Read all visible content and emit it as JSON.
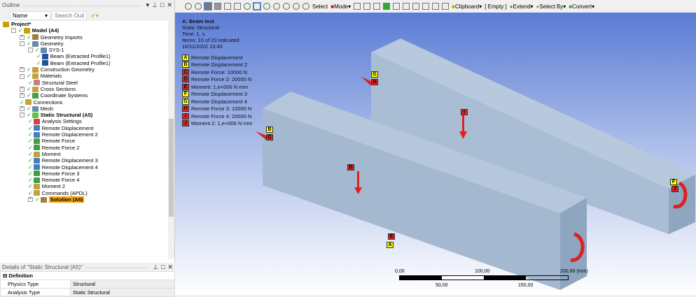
{
  "outline": {
    "title": "Outline",
    "name_select": "Name",
    "search_placeholder": "Search Outline",
    "items": [
      {
        "label": "Project*",
        "level": 0,
        "color": "#c8a000",
        "bold": true
      },
      {
        "label": "Model (A4)",
        "level": 1,
        "color": "#c8a000",
        "bold": true,
        "ex": "-"
      },
      {
        "label": "Geometry Imports",
        "level": 2,
        "color": "#a08040",
        "ex": "+"
      },
      {
        "label": "Geometry",
        "level": 2,
        "color": "#6a8ab0",
        "ex": "-"
      },
      {
        "label": "SYS-1",
        "level": 3,
        "color": "#6a8ab0",
        "ex": "-"
      },
      {
        "label": "Beam (Extracted Profile1)",
        "level": 4,
        "color": "#2050a0"
      },
      {
        "label": "Beam (Extracted Profile1)",
        "level": 4,
        "color": "#2050a0"
      },
      {
        "label": "Construction Geometry",
        "level": 2,
        "color": "#c8a040",
        "ex": "+"
      },
      {
        "label": "Materials",
        "level": 2,
        "color": "#c8a040",
        "ex": "-"
      },
      {
        "label": "Structural Steel",
        "level": 3,
        "color": "#c08080"
      },
      {
        "label": "Cross Sections",
        "level": 2,
        "color": "#c8a040",
        "ex": "+"
      },
      {
        "label": "Coordinate Systems",
        "level": 2,
        "color": "#40a040",
        "ex": "+"
      },
      {
        "label": "Connections",
        "level": 2,
        "color": "#c8a040"
      },
      {
        "label": "Mesh",
        "level": 2,
        "color": "#6a8ab0",
        "ex": "+"
      },
      {
        "label": "Static Structural (A5)",
        "level": 2,
        "color": "#60c040",
        "bold": true,
        "ex": "-"
      },
      {
        "label": "Analysis Settings",
        "level": 3,
        "color": "#d04040"
      },
      {
        "label": "Remote Displacement",
        "level": 3,
        "color": "#4080c0"
      },
      {
        "label": "Remote Displacement 2",
        "level": 3,
        "color": "#4080c0"
      },
      {
        "label": "Remote Force",
        "level": 3,
        "color": "#40a040"
      },
      {
        "label": "Remote Force 2",
        "level": 3,
        "color": "#40a040"
      },
      {
        "label": "Moment",
        "level": 3,
        "color": "#c0a040"
      },
      {
        "label": "Remote Displacement 3",
        "level": 3,
        "color": "#4080c0"
      },
      {
        "label": "Remote Displacement 4",
        "level": 3,
        "color": "#4080c0"
      },
      {
        "label": "Remote Force 3",
        "level": 3,
        "color": "#40a040"
      },
      {
        "label": "Remote Force 4",
        "level": 3,
        "color": "#40a040"
      },
      {
        "label": "Moment 2",
        "level": 3,
        "color": "#c0a040"
      },
      {
        "label": "Commands (APDL)",
        "level": 3,
        "color": "#c8a040"
      },
      {
        "label": "Solution (A6)",
        "level": 3,
        "color": "#a08040",
        "highlight": true,
        "ex": "+"
      }
    ]
  },
  "details": {
    "title": "Details of \"Static Structural (A5)\"",
    "section": "Definition",
    "rows": [
      {
        "k": "Physics Type",
        "v": "Structural"
      },
      {
        "k": "Analysis Type",
        "v": "Static Structural"
      }
    ]
  },
  "toolbar": {
    "select": "Select",
    "mode": "Mode",
    "clipboard": "Clipboard",
    "empty": "[ Empty ]",
    "extend": "Extend",
    "select_by": "Select By",
    "convert": "Convert"
  },
  "viewport": {
    "title": "A: Beam test",
    "type": "Static Structural",
    "time": "Time: 1, s",
    "items": "Items: 10 of 20 indicated",
    "date": "16/11/2022 13:43",
    "legend": [
      {
        "letter": "A",
        "label": "Remote Displacement",
        "color": "#ffff00"
      },
      {
        "letter": "B",
        "label": "Remote Displacement 2",
        "color": "#ffff00"
      },
      {
        "letter": "C",
        "label": "Remote Force: 10000 N",
        "color": "#e02020"
      },
      {
        "letter": "D",
        "label": "Remote Force 2: 20000 N",
        "color": "#e02020"
      },
      {
        "letter": "E",
        "label": "Moment: 1,e+006 N·mm",
        "color": "#e02020"
      },
      {
        "letter": "F",
        "label": "Remote Displacement 3",
        "color": "#ffff00"
      },
      {
        "letter": "G",
        "label": "Remote Displacement 4",
        "color": "#ffff00"
      },
      {
        "letter": "H",
        "label": "Remote Force 3: 10000 N",
        "color": "#e02020"
      },
      {
        "letter": "I",
        "label": "Remote Force 4: 20000 N",
        "color": "#e02020"
      },
      {
        "letter": "J",
        "label": "Moment 2: 1,e+006 N·mm",
        "color": "#e02020"
      }
    ],
    "scale": {
      "t0": "0,00",
      "t100": "100,00",
      "t200": "200,00 (mm)",
      "t50": "50,00",
      "t150": "150,00"
    }
  }
}
